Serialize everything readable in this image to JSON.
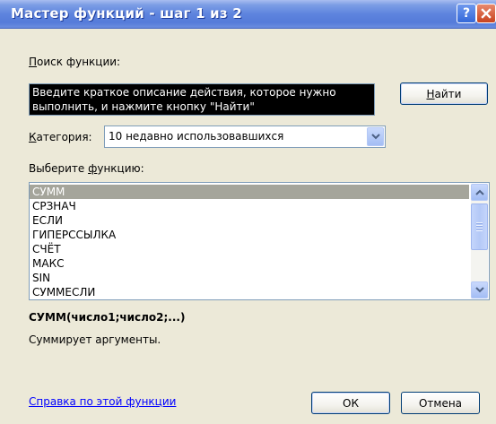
{
  "window": {
    "title": "Мастер функций - шаг 1 из 2",
    "help_glyph": "?",
    "close_glyph": "✕"
  },
  "search": {
    "label": "Поиск функции:",
    "label_hotkey": "П",
    "label_rest": "оиск функции:",
    "value": "Введите краткое описание действия, которое нужно выполнить, и нажмите кнопку \"Найти\"",
    "find_button": "Найти",
    "find_hotkey": "Н",
    "find_rest": "айти"
  },
  "category": {
    "label": "Категория:",
    "label_hotkey": "К",
    "label_rest": "атегория:",
    "selected": "10 недавно использовавшихся"
  },
  "function_list": {
    "label": "Выберите функцию:",
    "label_prefix": "Выберите ",
    "label_hotkey": "ф",
    "label_rest": "ункцию:",
    "items": [
      "СУММ",
      "СРЗНАЧ",
      "ЕСЛИ",
      "ГИПЕРССЫЛКА",
      "СЧЁТ",
      "МАКС",
      "SIN",
      "СУММЕСЛИ"
    ],
    "selected_index": 0
  },
  "details": {
    "syntax": "СУММ(число1;число2;...)",
    "description": "Суммирует аргументы."
  },
  "footer": {
    "help_link": "Справка по этой функции",
    "ok_button": "ОК",
    "cancel_button": "Отмена"
  },
  "colors": {
    "title_bar": "#5e84de",
    "dialog_bg": "#ece9d8",
    "selection": "#a5a59b",
    "link": "#0000ff"
  }
}
